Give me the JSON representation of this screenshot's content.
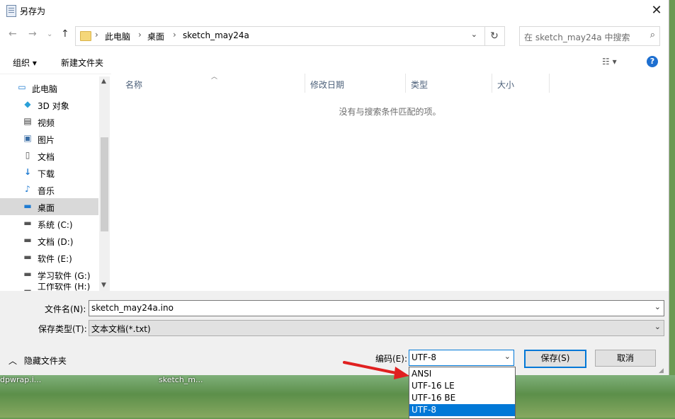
{
  "window": {
    "title": "另存为"
  },
  "nav": {
    "breadcrumb": [
      "此电脑",
      "桌面",
      "sketch_may24a"
    ],
    "search_placeholder": "在 sketch_may24a 中搜索"
  },
  "toolbar": {
    "organize": "组织 ▾",
    "new_folder": "新建文件夹"
  },
  "sidebar": {
    "items": [
      {
        "label": "此电脑",
        "icon": "computer-icon"
      },
      {
        "label": "3D 对象",
        "icon": "cube-icon"
      },
      {
        "label": "视频",
        "icon": "video-icon"
      },
      {
        "label": "图片",
        "icon": "picture-icon"
      },
      {
        "label": "文档",
        "icon": "document-icon"
      },
      {
        "label": "下载",
        "icon": "download-icon"
      },
      {
        "label": "音乐",
        "icon": "music-icon"
      },
      {
        "label": "桌面",
        "icon": "desktop-icon",
        "selected": true
      },
      {
        "label": "系统 (C:)",
        "icon": "drive-icon"
      },
      {
        "label": "文档 (D:)",
        "icon": "drive-icon"
      },
      {
        "label": "软件 (E:)",
        "icon": "drive-icon"
      },
      {
        "label": "学习软件 (G:)",
        "icon": "drive-icon"
      },
      {
        "label": "工作软件 (H:)",
        "icon": "drive-icon"
      }
    ]
  },
  "list": {
    "columns": [
      "名称",
      "修改日期",
      "类型",
      "大小"
    ],
    "empty_message": "没有与搜索条件匹配的项。"
  },
  "form": {
    "filename_label": "文件名(N):",
    "filename_value": "sketch_may24a.ino",
    "filetype_label": "保存类型(T):",
    "filetype_value": "文本文档(*.txt)",
    "hide_folders": "隐藏文件夹",
    "encoding_label": "编码(E):",
    "encoding_value": "UTF-8",
    "save_button": "保存(S)",
    "cancel_button": "取消"
  },
  "encoding_options": [
    "ANSI",
    "UTF-16 LE",
    "UTF-16 BE",
    "UTF-8"
  ],
  "encoding_selected": "UTF-8",
  "desktop": {
    "item_a": "dpwrap.i...",
    "item_b": "sketch_m..."
  },
  "colors": {
    "accent": "#0078d7",
    "annotation_arrow": "#e02020"
  }
}
